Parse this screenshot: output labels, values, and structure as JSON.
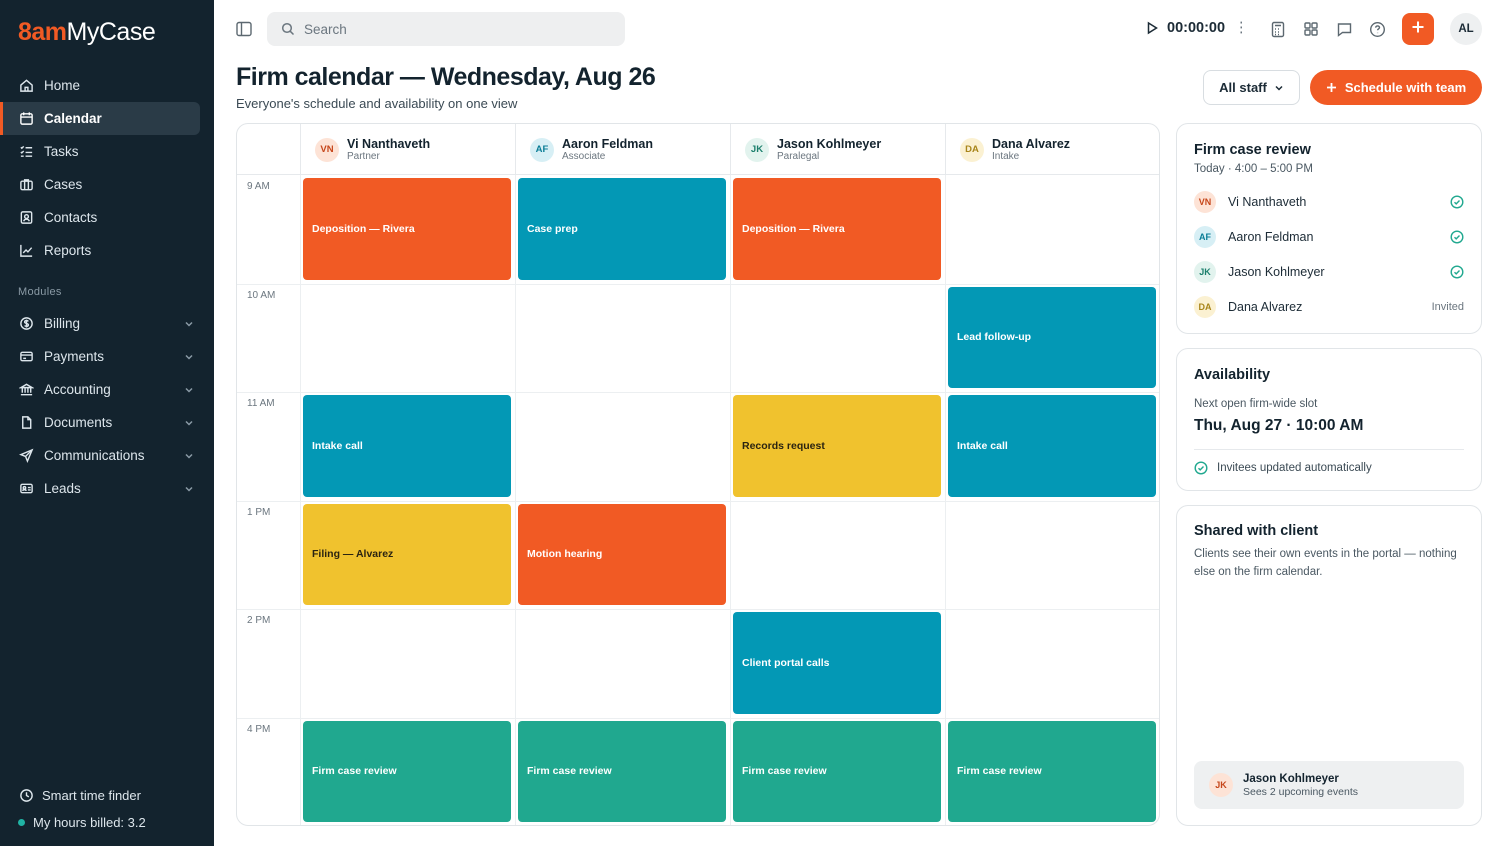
{
  "app": {
    "logo_prefix": "8am",
    "logo_suffix": "MyCase"
  },
  "sidebar": {
    "items": [
      {
        "label": "Home",
        "icon": "home-icon"
      },
      {
        "label": "Calendar",
        "icon": "calendar-icon",
        "active": true
      },
      {
        "label": "Tasks",
        "icon": "tasks-icon"
      },
      {
        "label": "Cases",
        "icon": "briefcase-icon"
      },
      {
        "label": "Contacts",
        "icon": "contacts-icon"
      },
      {
        "label": "Reports",
        "icon": "chart-icon"
      }
    ],
    "modules_label": "Modules",
    "modules": [
      {
        "label": "Billing",
        "icon": "dollar-icon"
      },
      {
        "label": "Payments",
        "icon": "card-icon"
      },
      {
        "label": "Accounting",
        "icon": "bank-icon"
      },
      {
        "label": "Documents",
        "icon": "document-icon"
      },
      {
        "label": "Communications",
        "icon": "send-icon"
      },
      {
        "label": "Leads",
        "icon": "id-card-icon"
      }
    ],
    "smart_time_finder": "Smart time finder",
    "hours_billed": "My hours billed: 3.2"
  },
  "topbar": {
    "search_placeholder": "Search",
    "timer": "00:00:00",
    "avatar": "AL"
  },
  "header": {
    "title": "Firm calendar — Wednesday, Aug 26",
    "subtitle": "Everyone's schedule and availability on one view",
    "staff_filter": "All staff",
    "schedule_button": "Schedule with team"
  },
  "calendar": {
    "staff": [
      {
        "initials": "VN",
        "name": "Vi Nanthaveth",
        "role": "Partner",
        "avatar_bg": "#fde3d6",
        "avatar_fg": "#c6461a"
      },
      {
        "initials": "AF",
        "name": "Aaron Feldman",
        "role": "Associate",
        "avatar_bg": "#d7eff5",
        "avatar_fg": "#0a7d96"
      },
      {
        "initials": "JK",
        "name": "Jason Kohlmeyer",
        "role": "Paralegal",
        "avatar_bg": "#e2f3ee",
        "avatar_fg": "#1b7f6c"
      },
      {
        "initials": "DA",
        "name": "Dana Alvarez",
        "role": "Intake",
        "avatar_bg": "#fbf1d2",
        "avatar_fg": "#a8851a"
      }
    ],
    "times": [
      "9 AM",
      "10 AM",
      "11 AM",
      "1 PM",
      "2 PM",
      "4 PM"
    ],
    "events": [
      {
        "staff": 0,
        "slot": 0,
        "title": "Deposition — Rivera",
        "color": "orange"
      },
      {
        "staff": 1,
        "slot": 0,
        "title": "Case prep",
        "color": "blue"
      },
      {
        "staff": 2,
        "slot": 0,
        "title": "Deposition — Rivera",
        "color": "orange"
      },
      {
        "staff": 3,
        "slot": 1,
        "title": "Lead follow-up",
        "color": "blue"
      },
      {
        "staff": 0,
        "slot": 2,
        "title": "Intake call",
        "color": "blue"
      },
      {
        "staff": 2,
        "slot": 2,
        "title": "Records request",
        "color": "yellow"
      },
      {
        "staff": 3,
        "slot": 2,
        "title": "Intake call",
        "color": "blue"
      },
      {
        "staff": 0,
        "slot": 3,
        "title": "Filing — Alvarez",
        "color": "yellow"
      },
      {
        "staff": 1,
        "slot": 3,
        "title": "Motion hearing",
        "color": "orange"
      },
      {
        "staff": 2,
        "slot": 4,
        "title": "Client portal calls",
        "color": "blue"
      },
      {
        "staff": 0,
        "slot": 5,
        "title": "Firm case review",
        "color": "green"
      },
      {
        "staff": 1,
        "slot": 5,
        "title": "Firm case review",
        "color": "green"
      },
      {
        "staff": 2,
        "slot": 5,
        "title": "Firm case review",
        "color": "green"
      },
      {
        "staff": 3,
        "slot": 5,
        "title": "Firm case review",
        "color": "green"
      }
    ]
  },
  "review_card": {
    "title": "Firm case review",
    "time": "Today · 4:00 – 5:00 PM",
    "attendees": [
      {
        "initials": "VN",
        "name": "Vi Nanthaveth",
        "status": "accepted"
      },
      {
        "initials": "AF",
        "name": "Aaron Feldman",
        "status": "accepted"
      },
      {
        "initials": "JK",
        "name": "Jason Kohlmeyer",
        "status": "accepted"
      },
      {
        "initials": "DA",
        "name": "Dana Alvarez",
        "status": "Invited"
      }
    ]
  },
  "availability_card": {
    "title": "Availability",
    "next_label": "Next open firm-wide slot",
    "next_slot": "Thu, Aug 27 · 10:00 AM",
    "note": "Invitees updated automatically"
  },
  "shared_card": {
    "title": "Shared with client",
    "description": "Clients see their own events in the portal — nothing else on the firm calendar.",
    "client_initials": "JK",
    "client_name": "Jason Kohlmeyer",
    "client_sub": "Sees 2 upcoming events"
  },
  "colors": {
    "accent": "#f15a24",
    "sidebar_bg": "#13232e",
    "orange": "#f15a24",
    "blue": "#0398b5",
    "yellow": "#f0c22e",
    "green": "#20a88f"
  }
}
